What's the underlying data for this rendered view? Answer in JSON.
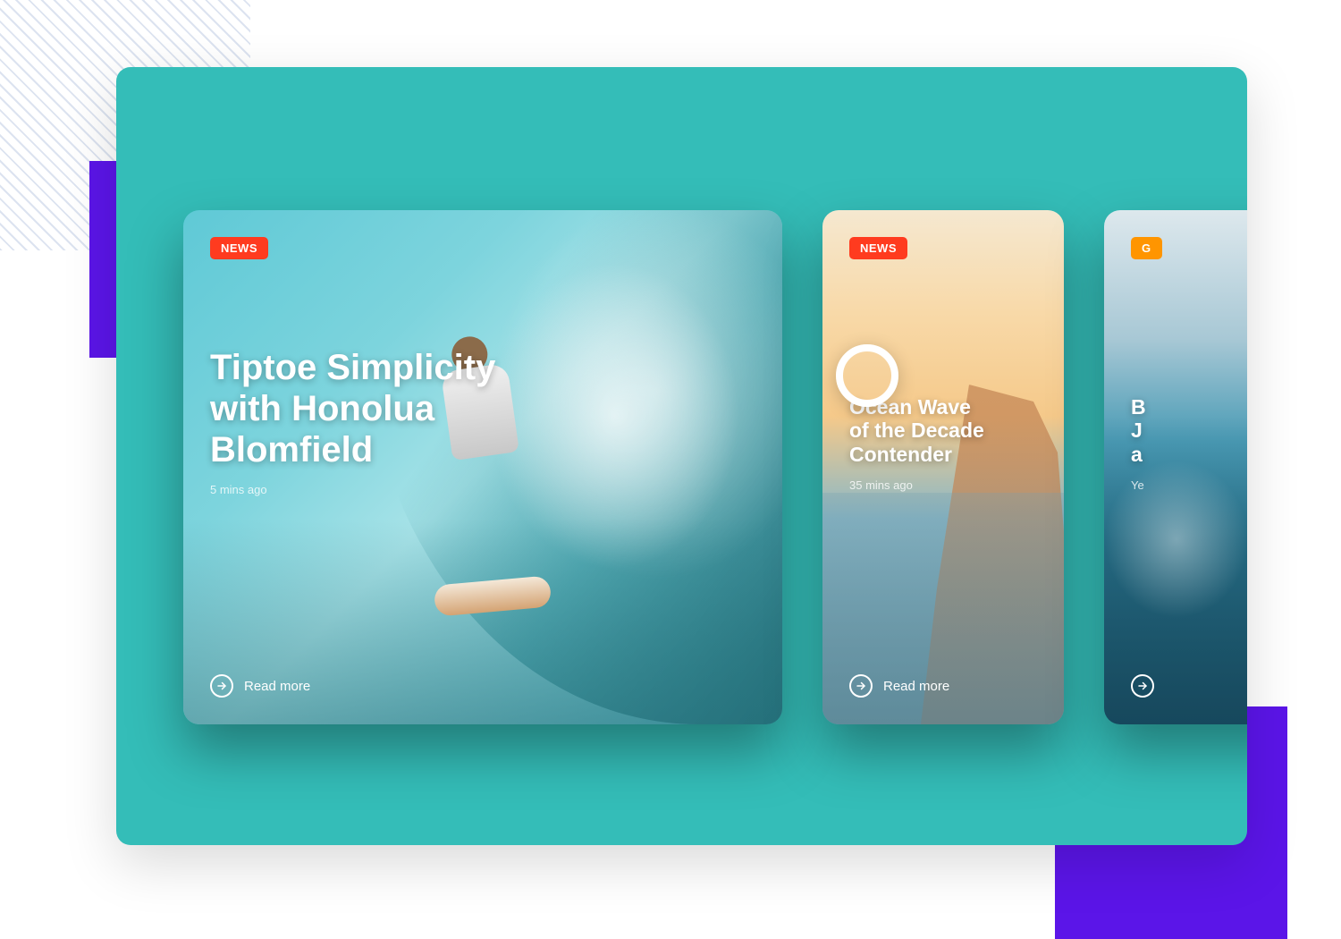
{
  "cards": [
    {
      "badge": "NEWS",
      "title_line1": "Tiptoe Simplicity",
      "title_line2": "with Honolua",
      "title_line3": "Blomfield",
      "timestamp": "5 mins ago",
      "read_more": "Read more"
    },
    {
      "badge": "NEWS",
      "title_line1": "Ocean Wave",
      "title_line2": "of the Decade",
      "title_line3": "Contender",
      "timestamp": "35 mins ago",
      "read_more": "Read more"
    },
    {
      "badge": "G",
      "title_line1": "B",
      "title_line2": "J",
      "title_line3": "a",
      "timestamp": "Ye"
    }
  ],
  "colors": {
    "teal": "#34bdb8",
    "purple": "#5b15e8",
    "badge_red": "#ff3b1f",
    "badge_orange": "#ff9500"
  }
}
